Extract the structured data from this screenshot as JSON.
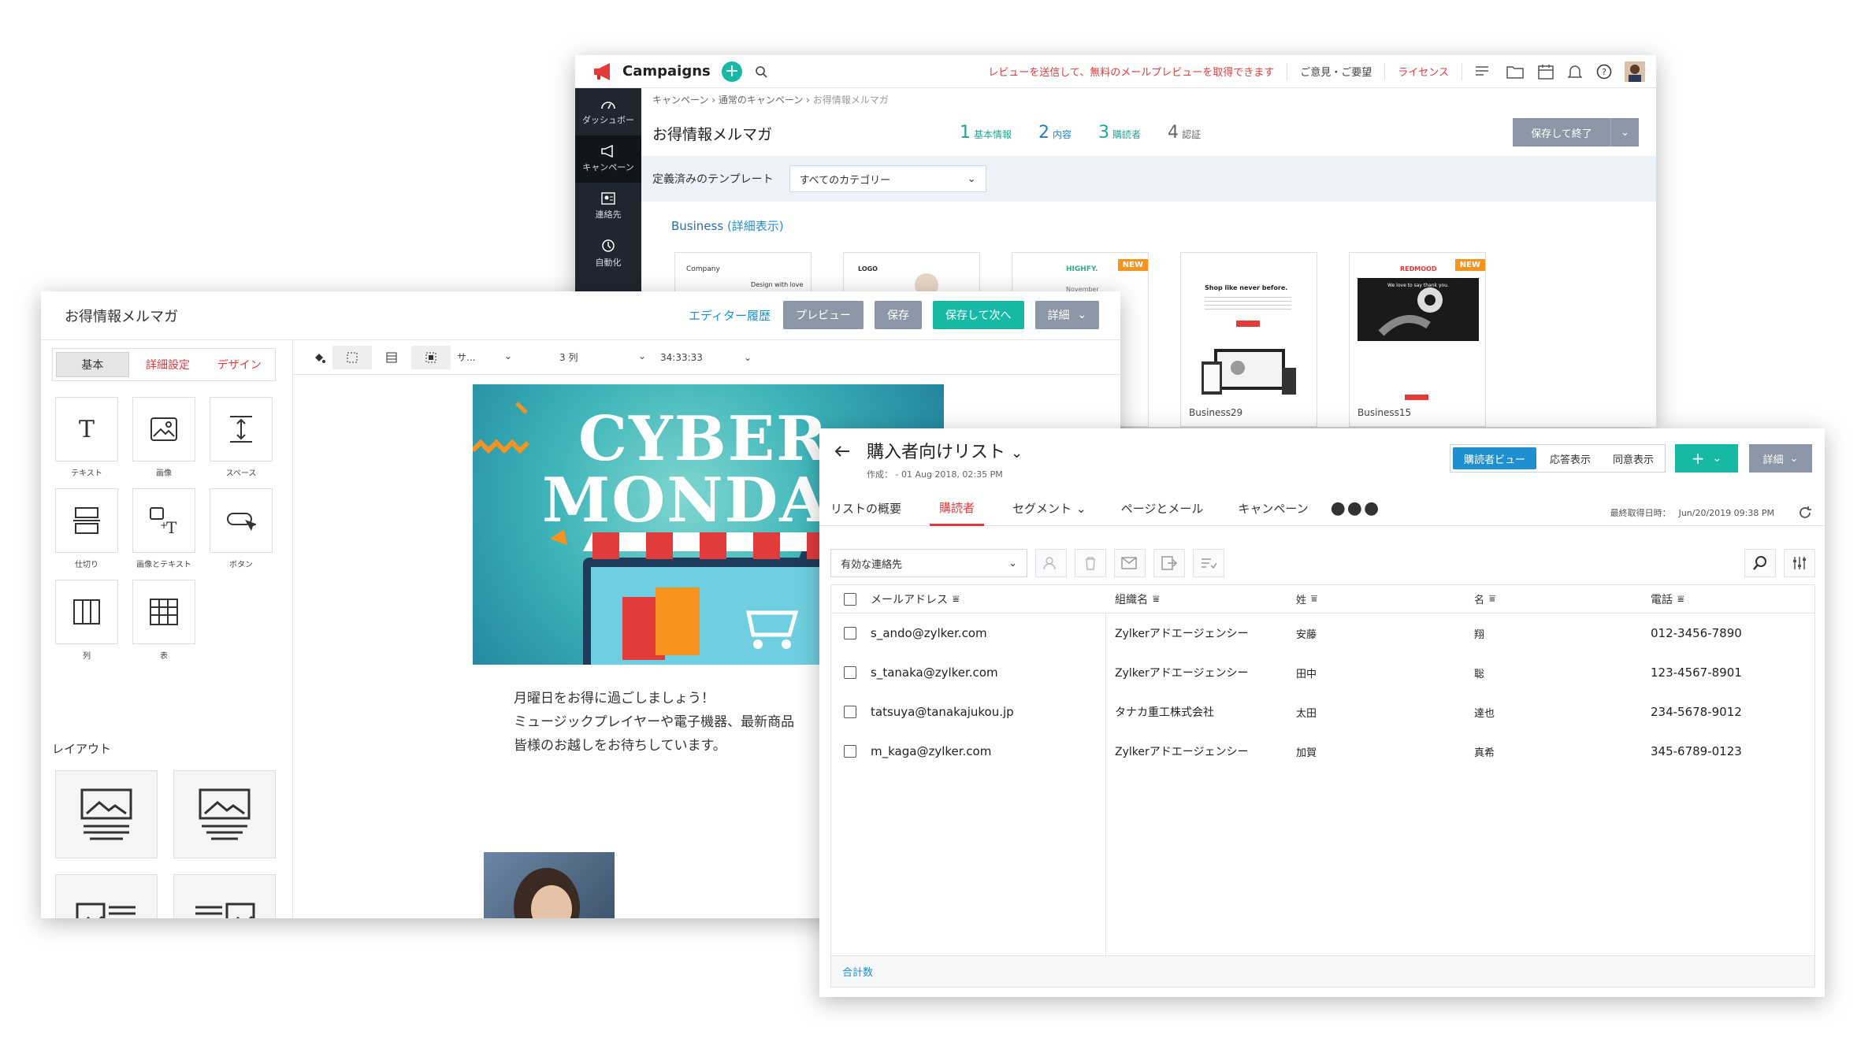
{
  "campaigns": {
    "app_name": "Campaigns",
    "banner_text": "レビューを送信して、無料のメールプレビューを取得できます",
    "feedback": "ご意見・ご要望",
    "license": "ライセンス",
    "sidebar": [
      {
        "label": "ダッシュボー",
        "icon": "dashboard-icon"
      },
      {
        "label": "キャンペーン",
        "icon": "megaphone-icon"
      },
      {
        "label": "連絡先",
        "icon": "contacts-icon"
      },
      {
        "label": "自動化",
        "icon": "automation-icon"
      }
    ],
    "breadcrumb": [
      "キャンペーン",
      "通常のキャンペーン",
      "お得情報メルマガ"
    ],
    "title": "お得情報メルマガ",
    "steps": [
      {
        "num": "1",
        "label": "基本情報"
      },
      {
        "num": "2",
        "label": "内容"
      },
      {
        "num": "3",
        "label": "購読者"
      },
      {
        "num": "4",
        "label": "認証"
      }
    ],
    "save_exit": "保存して終了",
    "template_label": "定義済みのテンプレート",
    "category_select": "すべてのカテゴリー",
    "section": "Business",
    "section_link": "(詳細表示)",
    "templates": [
      {
        "name": "",
        "logo": "Company",
        "line": "Design with love",
        "new": false
      },
      {
        "name": "",
        "logo": "LOGO",
        "line": "",
        "new": false
      },
      {
        "name": "",
        "logo": "HIGHFY.",
        "line": "November",
        "new": true
      },
      {
        "name": "Business29",
        "logo": "",
        "line": "Shop like never before.",
        "new": false
      },
      {
        "name": "Business15",
        "logo": "REDMOOD",
        "line": "We love to say thank you.",
        "new": true
      }
    ],
    "new_badge": "NEW"
  },
  "editor": {
    "title": "お得情報メルマガ",
    "history": "エディター履歴",
    "preview": "プレビュー",
    "save": "保存",
    "save_next": "保存して次へ",
    "details": "詳細",
    "tabs": [
      "基本",
      "詳細設定",
      "デザイン"
    ],
    "blocks": [
      "テキスト",
      "画像",
      "スペース",
      "仕切り",
      "画像とテキスト",
      "ボタン",
      "列",
      "表"
    ],
    "layout_title": "レイアウト",
    "toolbar": {
      "font": "サ...",
      "columns": "3 列",
      "color": "34:33:33"
    },
    "hero_line1": "CYBER",
    "hero_line2": "MONDA",
    "body_lines": [
      "月曜日をお得に過ごしましょう！",
      "ミュージックプレイヤーや電子機器、最新商品",
      "皆様のお越しをお待ちしています。"
    ]
  },
  "list": {
    "title": "購入者向けリスト",
    "created": "作成：  - 01 Aug 2018, 02:35 PM",
    "views": [
      "購読者ビュー",
      "応答表示",
      "同意表示"
    ],
    "details": "詳細",
    "nav": [
      "リストの概要",
      "購読者",
      "セグメント",
      "ページとメール",
      "キャンペーン"
    ],
    "last_fetch_label": "最終取得日時：",
    "last_fetch_value": "Jun/20/2019 09:38 PM",
    "filter": "有効な連絡先",
    "columns": [
      "メールアドレス",
      "組織名",
      "姓",
      "名",
      "電話"
    ],
    "rows": [
      {
        "email": "s_ando@zylker.com",
        "org": "Zylkerアドエージェンシー",
        "last": "安藤",
        "first": "翔",
        "phone": "012-3456-7890"
      },
      {
        "email": "s_tanaka@zylker.com",
        "org": "Zylkerアドエージェンシー",
        "last": "田中",
        "first": "聡",
        "phone": "123-4567-8901"
      },
      {
        "email": "tatsuya@tanakajukou.jp",
        "org": "タナカ重工株式会社",
        "last": "太田",
        "first": "達也",
        "phone": "234-5678-9012"
      },
      {
        "email": "m_kaga@zylker.com",
        "org": "Zylkerアドエージェンシー",
        "last": "加賀",
        "first": "真希",
        "phone": "345-6789-0123"
      }
    ],
    "footer": "合計数"
  },
  "colors": {
    "accent": "#17b8a6",
    "link": "#1f8fd0",
    "alert": "#e23b3b",
    "sidebar": "#1e2630",
    "button_gray": "#8b97a6"
  }
}
